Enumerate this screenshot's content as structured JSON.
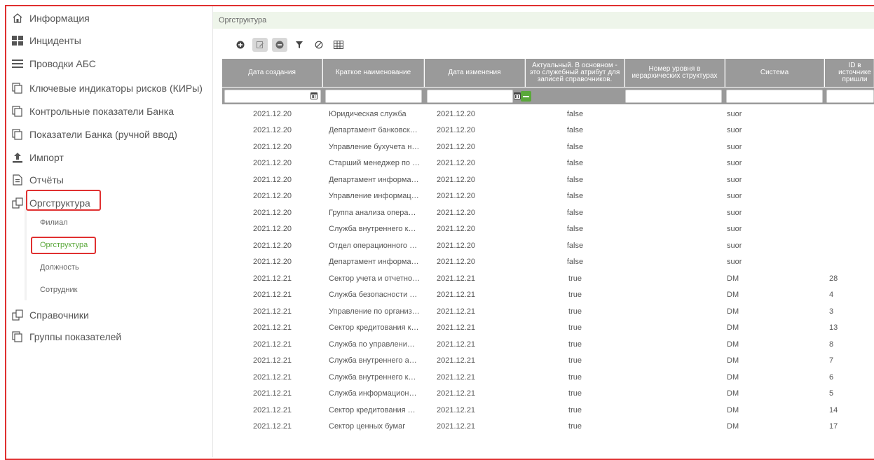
{
  "sidebar": {
    "items": [
      {
        "label": "Информация",
        "icon": "home-icon"
      },
      {
        "label": "Инциденты",
        "icon": "grid-icon"
      },
      {
        "label": "Проводки АБС",
        "icon": "menu-icon"
      },
      {
        "label": "Ключевые индикаторы рисков (КИРы)",
        "icon": "copy-icon"
      },
      {
        "label": "Контрольные показатели Банка",
        "icon": "copy-icon"
      },
      {
        "label": "Показатели Банка (ручной ввод)",
        "icon": "copy-icon"
      },
      {
        "label": "Импорт",
        "icon": "upload-icon"
      },
      {
        "label": "Отчёты",
        "icon": "document-icon"
      },
      {
        "label": "Оргструктура",
        "icon": "org-icon"
      },
      {
        "label": "Справочники",
        "icon": "org-icon"
      },
      {
        "label": "Группы показателей",
        "icon": "copy-icon"
      }
    ],
    "sub_items": [
      {
        "label": "Филиал"
      },
      {
        "label": "Оргструктура"
      },
      {
        "label": "Должность"
      },
      {
        "label": "Сотрудник"
      }
    ]
  },
  "breadcrumb": "Оргструктура",
  "toolbar": {
    "icons": [
      "add-icon",
      "edit-icon",
      "remove-icon",
      "filter-icon",
      "clear-filter-icon",
      "columns-icon"
    ]
  },
  "table": {
    "columns": [
      "Дата создания",
      "Краткое наименование",
      "Дата изменения",
      "Актуальный. В основном - это служебный атрибут для записей справочников.",
      "Номер уровня в иерархических структурах",
      "Система",
      "ID в источнике пришли"
    ],
    "rows": [
      [
        "2021.12.20",
        "Юридическая служба",
        "2021.12.20",
        "false",
        "",
        "suor",
        ""
      ],
      [
        "2021.12.20",
        "Департамент банковск…",
        "2021.12.20",
        "false",
        "",
        "suor",
        ""
      ],
      [
        "2021.12.20",
        "Управление бухучета н…",
        "2021.12.20",
        "false",
        "",
        "suor",
        ""
      ],
      [
        "2021.12.20",
        "Старший менеджер по …",
        "2021.12.20",
        "false",
        "",
        "suor",
        ""
      ],
      [
        "2021.12.20",
        "Департамент информа…",
        "2021.12.20",
        "false",
        "",
        "suor",
        ""
      ],
      [
        "2021.12.20",
        "Управление информац…",
        "2021.12.20",
        "false",
        "",
        "suor",
        ""
      ],
      [
        "2021.12.20",
        "Группа анализа опера…",
        "2021.12.20",
        "false",
        "",
        "suor",
        ""
      ],
      [
        "2021.12.20",
        "Служба внутреннего к…",
        "2021.12.20",
        "false",
        "",
        "suor",
        ""
      ],
      [
        "2021.12.20",
        "Отдел операционного …",
        "2021.12.20",
        "false",
        "",
        "suor",
        ""
      ],
      [
        "2021.12.20",
        "Департамент информа…",
        "2021.12.20",
        "false",
        "",
        "suor",
        ""
      ],
      [
        "2021.12.21",
        "Сектор учета и отчетно…",
        "2021.12.21",
        "true",
        "",
        "DM",
        "28"
      ],
      [
        "2021.12.21",
        "Служба безопасности …",
        "2021.12.21",
        "true",
        "",
        "DM",
        "4"
      ],
      [
        "2021.12.21",
        "Управление по организ…",
        "2021.12.21",
        "true",
        "",
        "DM",
        "3"
      ],
      [
        "2021.12.21",
        "Сектор кредитования к…",
        "2021.12.21",
        "true",
        "",
        "DM",
        "13"
      ],
      [
        "2021.12.21",
        "Служба по управлени…",
        "2021.12.21",
        "true",
        "",
        "DM",
        "8"
      ],
      [
        "2021.12.21",
        "Служба внутреннего а…",
        "2021.12.21",
        "true",
        "",
        "DM",
        "7"
      ],
      [
        "2021.12.21",
        "Служба внутреннего к…",
        "2021.12.21",
        "true",
        "",
        "DM",
        "6"
      ],
      [
        "2021.12.21",
        "Служба информацион…",
        "2021.12.21",
        "true",
        "",
        "DM",
        "5"
      ],
      [
        "2021.12.21",
        "Сектор кредитования …",
        "2021.12.21",
        "true",
        "",
        "DM",
        "14"
      ],
      [
        "2021.12.21",
        "Сектор ценных бумаг",
        "2021.12.21",
        "true",
        "",
        "DM",
        "17"
      ]
    ]
  },
  "colors": {
    "accent": "#5aa83a",
    "header": "#9a9a9a",
    "highlight": "#e03030",
    "crumb_bg": "#eef5ea"
  }
}
